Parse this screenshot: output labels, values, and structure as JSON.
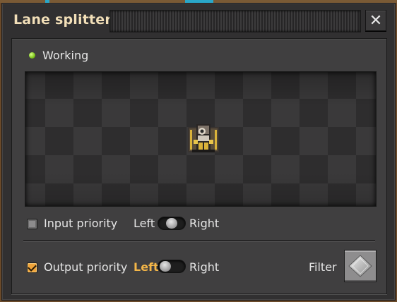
{
  "window": {
    "title": "Lane splitter",
    "close_icon": "close-icon"
  },
  "status": {
    "text": "Working",
    "led_color": "#7cc41c"
  },
  "preview": {
    "entity_icon": "splitter-entity"
  },
  "input_priority": {
    "label": "Input priority",
    "checked": false,
    "left_label": "Left",
    "right_label": "Right",
    "selected": "none"
  },
  "output_priority": {
    "label": "Output priority",
    "checked": true,
    "left_label": "Left",
    "right_label": "Right",
    "selected": "left",
    "filter_label": "Filter",
    "filter_icon": "filter-diamond-icon"
  },
  "colors": {
    "accent": "#f4b648",
    "title": "#f2dfb8"
  }
}
